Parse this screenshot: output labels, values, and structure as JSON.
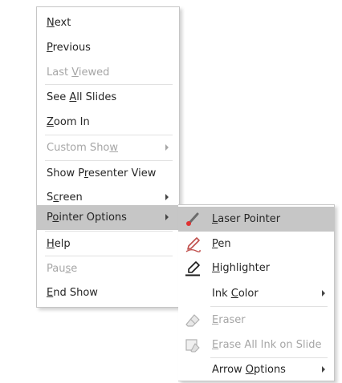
{
  "main_menu": {
    "items": [
      {
        "pre": "",
        "u": "N",
        "post": "ext"
      },
      {
        "pre": "",
        "u": "P",
        "post": "revious"
      },
      {
        "pre": "Last ",
        "u": "V",
        "post": "iewed"
      },
      {
        "pre": "See ",
        "u": "A",
        "post": "ll Slides"
      },
      {
        "pre": "",
        "u": "Z",
        "post": "oom In"
      },
      {
        "pre": "Custom Sho",
        "u": "w",
        "post": ""
      },
      {
        "pre": "Show P",
        "u": "r",
        "post": "esenter View"
      },
      {
        "pre": "S",
        "u": "c",
        "post": "reen"
      },
      {
        "pre": "P",
        "u": "o",
        "post": "inter Options"
      },
      {
        "pre": "",
        "u": "H",
        "post": "elp"
      },
      {
        "pre": "Pau",
        "u": "s",
        "post": "e"
      },
      {
        "pre": "",
        "u": "E",
        "post": "nd Show"
      }
    ]
  },
  "sub_menu": {
    "items": [
      {
        "pre": "",
        "u": "L",
        "post": "aser Pointer"
      },
      {
        "pre": "",
        "u": "P",
        "post": "en"
      },
      {
        "pre": "",
        "u": "H",
        "post": "ighlighter"
      },
      {
        "pre": "Ink ",
        "u": "C",
        "post": "olor"
      },
      {
        "pre": "",
        "u": "E",
        "post": "raser"
      },
      {
        "pre": "",
        "u": "E",
        "post": "rase All Ink on Slide"
      },
      {
        "pre": "Arrow ",
        "u": "O",
        "post": "ptions"
      }
    ]
  },
  "colors": {
    "highlight": "#c6c6c6",
    "disabled_text": "#a6a6a6",
    "pen_red": "#c0504d",
    "laser_red": "#e03131"
  },
  "icons": {
    "laser_pointer": "laser-pointer-icon",
    "pen": "pen-icon",
    "highlighter": "highlighter-icon",
    "eraser": "eraser-icon",
    "erase_all": "erase-all-ink-icon"
  }
}
